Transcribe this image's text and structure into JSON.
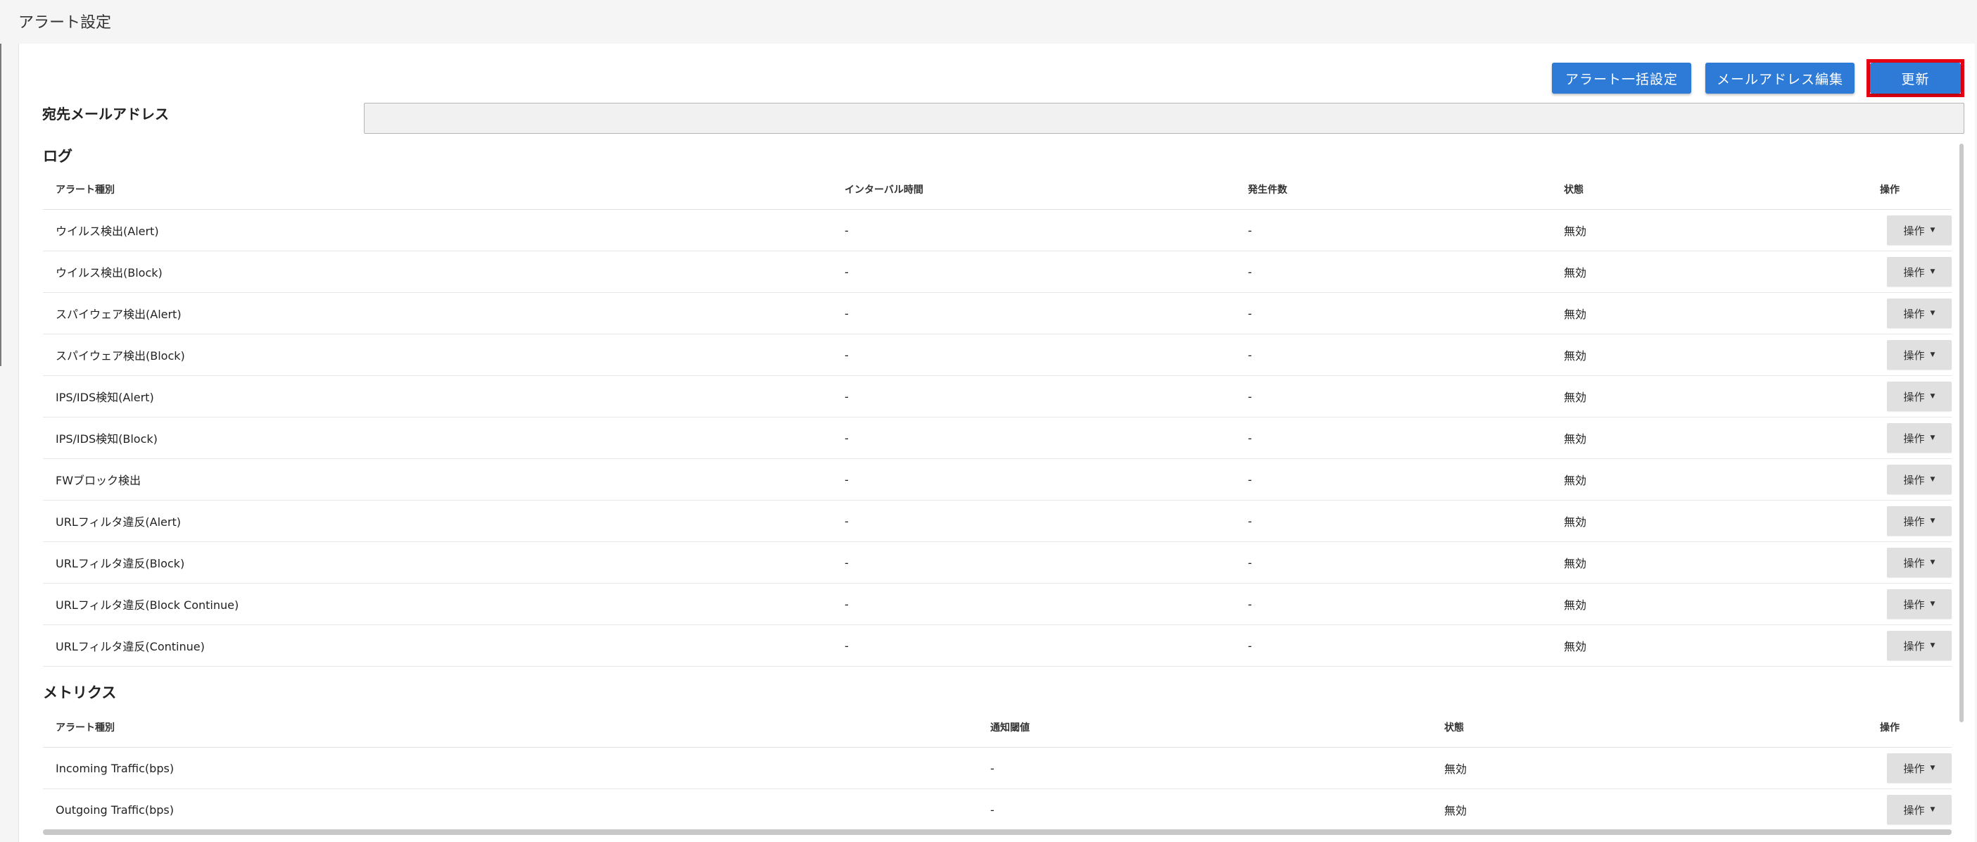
{
  "page": {
    "title": "アラート設定"
  },
  "toolbar": {
    "bulk_label": "アラート一括設定",
    "mail_edit_label": "メールアドレス編集",
    "update_label": "更新",
    "update_highlight_color": "#e50012",
    "accent_color": "#2d7bd7"
  },
  "mail": {
    "label": "宛先メールアドレス",
    "value": ""
  },
  "log": {
    "title": "ログ",
    "headers": {
      "type": "アラート種別",
      "interval": "インターバル時間",
      "count": "発生件数",
      "status": "状態",
      "action": "操作"
    },
    "rows": [
      {
        "type": "ウイルス検出(Alert)",
        "interval": "-",
        "count": "-",
        "status": "無効",
        "action": "操作"
      },
      {
        "type": "ウイルス検出(Block)",
        "interval": "-",
        "count": "-",
        "status": "無効",
        "action": "操作"
      },
      {
        "type": "スパイウェア検出(Alert)",
        "interval": "-",
        "count": "-",
        "status": "無効",
        "action": "操作"
      },
      {
        "type": "スパイウェア検出(Block)",
        "interval": "-",
        "count": "-",
        "status": "無効",
        "action": "操作"
      },
      {
        "type": "IPS/IDS検知(Alert)",
        "interval": "-",
        "count": "-",
        "status": "無効",
        "action": "操作"
      },
      {
        "type": "IPS/IDS検知(Block)",
        "interval": "-",
        "count": "-",
        "status": "無効",
        "action": "操作"
      },
      {
        "type": "FWブロック検出",
        "interval": "-",
        "count": "-",
        "status": "無効",
        "action": "操作"
      },
      {
        "type": "URLフィルタ違反(Alert)",
        "interval": "-",
        "count": "-",
        "status": "無効",
        "action": "操作"
      },
      {
        "type": "URLフィルタ違反(Block)",
        "interval": "-",
        "count": "-",
        "status": "無効",
        "action": "操作"
      },
      {
        "type": "URLフィルタ違反(Block Continue)",
        "interval": "-",
        "count": "-",
        "status": "無効",
        "action": "操作"
      },
      {
        "type": "URLフィルタ違反(Continue)",
        "interval": "-",
        "count": "-",
        "status": "無効",
        "action": "操作"
      }
    ]
  },
  "metrics": {
    "title": "メトリクス",
    "headers": {
      "type": "アラート種別",
      "threshold": "通知閾値",
      "status": "状態",
      "action": "操作"
    },
    "rows": [
      {
        "type": "Incoming Traffic(bps)",
        "threshold": "-",
        "status": "無効",
        "action": "操作"
      },
      {
        "type": "Outgoing Traffic(bps)",
        "threshold": "-",
        "status": "無効",
        "action": "操作"
      }
    ]
  },
  "icons": {
    "dropdown_caret": "caret-down-icon"
  }
}
